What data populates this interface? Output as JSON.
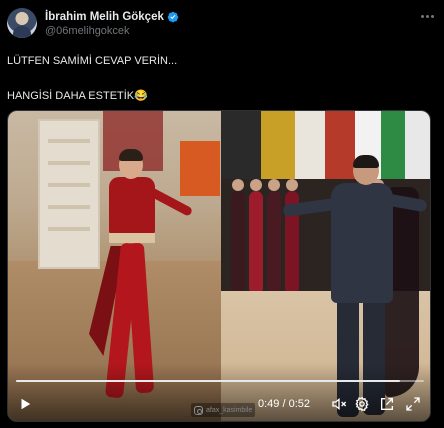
{
  "author": {
    "display_name": "İbrahim Melih Gökçek",
    "handle": "@06melihgokcek",
    "verified": true,
    "verified_color": "#1d9bf0"
  },
  "tweet": {
    "line1": "LÜTFEN SAMİMİ CEVAP VERİN...",
    "line2": "HANGİSİ DAHA ESTETİK😂"
  },
  "video": {
    "watermark": "afax_kasimbile",
    "time_label": "0:49 / 0:52",
    "progress": 0.94,
    "state": "paused",
    "icons": {
      "play": "play-icon",
      "mute": "volume-mute-icon",
      "settings": "gear-icon",
      "pip": "picture-in-picture-icon",
      "fullscreen": "fullscreen-icon"
    }
  },
  "menu_icon": "more-icon",
  "colors": {
    "background": "#000000",
    "text": "#e7e9ea",
    "secondary_text": "#71767b"
  }
}
